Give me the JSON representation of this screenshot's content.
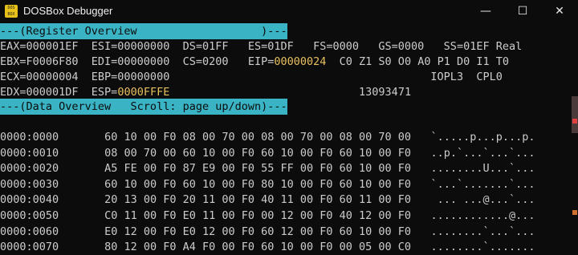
{
  "window": {
    "title": "DOSBox Debugger",
    "icon_text": "DOS BOX",
    "min_glyph": "—",
    "max_glyph": "☐",
    "close_glyph": "✕"
  },
  "register_header": "---(Register Overview                   )---",
  "registers": {
    "row1": "EAX=000001EF  ESI=00000000  DS=01FF   ES=01DF   FS=0000   GS=0000   SS=01EF Real",
    "row2_pre": "EBX=F0006F80  EDI=00000000  CS=0200   EIP=",
    "eip": "00000024",
    "row2_post": "  C0 Z1 S0 O0 A0 P1 D0 I1 T0",
    "row3": "ECX=00000004  EBP=00000000                                        IOPL3  CPL0",
    "row4_pre": "EDX=000001DF  ESP=",
    "esp": "0000FFFE",
    "row4_post": "                             13093471"
  },
  "data_header": "---(Data Overview   Scroll: page up/down)---",
  "memory": [
    {
      "addr": "0000:0000",
      "bytes": "60 10 00 F0 08 00 70 00 08 00 70 00 08 00 70 00",
      "ascii": "`.....p...p...p."
    },
    {
      "addr": "0000:0010",
      "bytes": "08 00 70 00 60 10 00 F0 60 10 00 F0 60 10 00 F0",
      "ascii": "..p.`...`...`..."
    },
    {
      "addr": "0000:0020",
      "bytes": "A5 FE 00 F0 87 E9 00 F0 55 FF 00 F0 60 10 00 F0",
      "ascii": "........U...`..."
    },
    {
      "addr": "0000:0030",
      "bytes": "60 10 00 F0 60 10 00 F0 80 10 00 F0 60 10 00 F0",
      "ascii": "`...`.......`..."
    },
    {
      "addr": "0000:0040",
      "bytes": "20 13 00 F0 20 11 00 F0 40 11 00 F0 60 11 00 F0",
      "ascii": " ... ...@...`..."
    },
    {
      "addr": "0000:0050",
      "bytes": "C0 11 00 F0 E0 11 00 F0 00 12 00 F0 40 12 00 F0",
      "ascii": "............@..."
    },
    {
      "addr": "0000:0060",
      "bytes": "E0 12 00 F0 E0 12 00 F0 60 12 00 F0 60 10 00 F0",
      "ascii": "........`...`..."
    },
    {
      "addr": "0000:0070",
      "bytes": "80 12 00 F0 A4 F0 00 F0 60 10 00 F0 00 05 00 C0",
      "ascii": "........`......."
    }
  ],
  "colors": {
    "header_bg": "#3ab3c4",
    "highlight": "#e8c05e",
    "text": "#cccccc",
    "bg": "#0c0c0c"
  }
}
